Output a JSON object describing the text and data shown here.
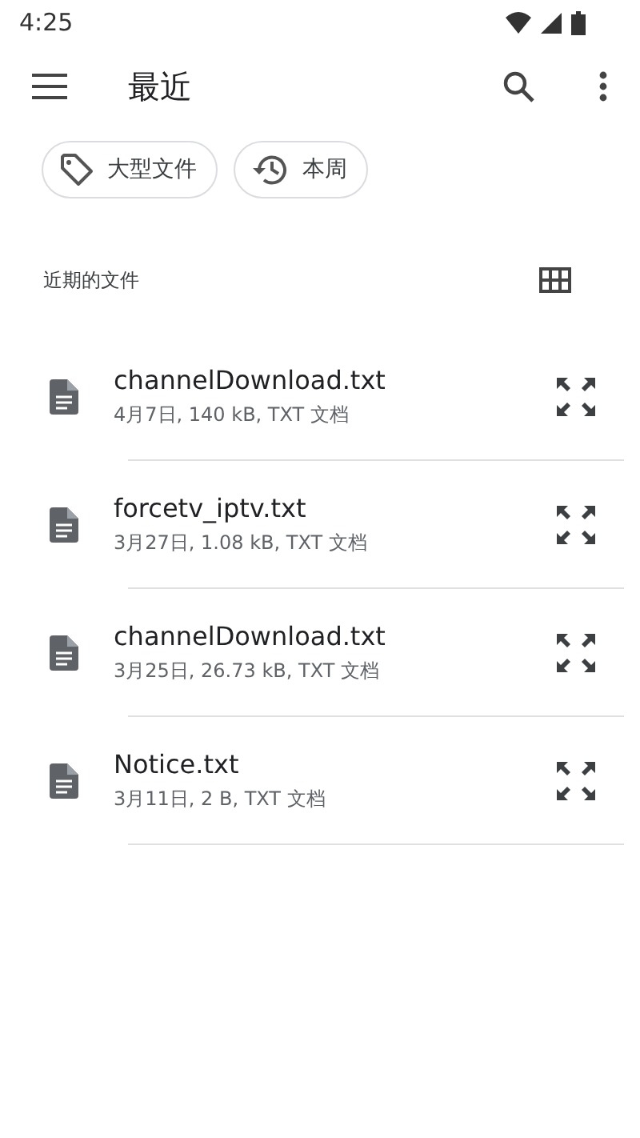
{
  "status_bar": {
    "time": "4:25"
  },
  "toolbar": {
    "title": "最近"
  },
  "chips": [
    {
      "label": "大型文件",
      "kind": "size"
    },
    {
      "label": "本周",
      "kind": "time"
    }
  ],
  "section": {
    "title": "近期的文件"
  },
  "files": [
    {
      "name": "channelDownload.txt",
      "meta": "4月7日, 140 kB, TXT 文档"
    },
    {
      "name": "forcetv_iptv.txt",
      "meta": "3月27日, 1.08 kB, TXT 文档"
    },
    {
      "name": "channelDownload.txt",
      "meta": "3月25日, 26.73 kB, TXT 文档"
    },
    {
      "name": "Notice.txt",
      "meta": "3月11日, 2 B, TXT 文档"
    }
  ]
}
